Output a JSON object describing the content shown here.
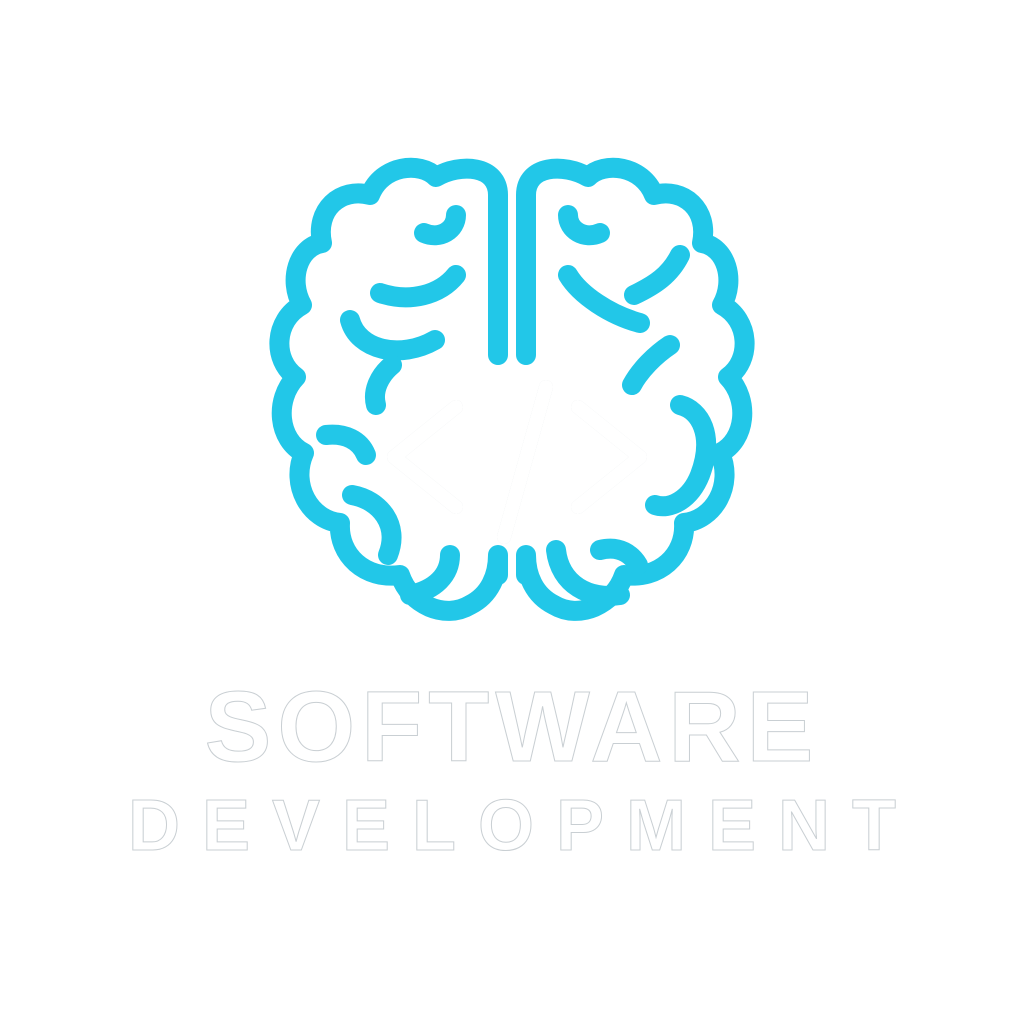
{
  "logo": {
    "icon": "brain-icon",
    "inner_icon": "code-brackets-icon",
    "inner_symbol": "</>"
  },
  "wordmark": {
    "line_1": "SOFTWARE",
    "line_2": "DEVELOPMENT"
  },
  "colors": {
    "background": "#ffffff",
    "brain": "#22c7e8",
    "text_fill": "#ffffff",
    "text_outline": "#c9cfd3"
  }
}
